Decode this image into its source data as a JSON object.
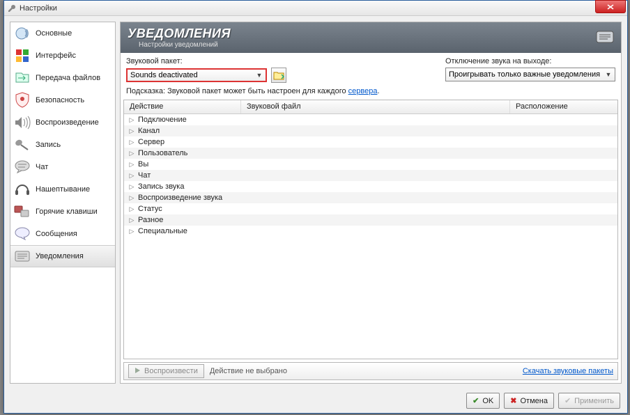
{
  "window": {
    "title": "Настройки"
  },
  "sidebar": {
    "items": [
      {
        "label": "Основные"
      },
      {
        "label": "Интерфейс"
      },
      {
        "label": "Передача файлов"
      },
      {
        "label": "Безопасность"
      },
      {
        "label": "Воспроизведение"
      },
      {
        "label": "Запись"
      },
      {
        "label": "Чат"
      },
      {
        "label": "Нашептывание"
      },
      {
        "label": "Горячие клавиши"
      },
      {
        "label": "Сообщения"
      },
      {
        "label": "Уведомления"
      }
    ]
  },
  "header": {
    "title": "УВЕДОМЛЕНИЯ",
    "subtitle": "Настройки уведомлений"
  },
  "controls": {
    "sound_pack_label": "Звуковой пакет:",
    "sound_pack_value": "Sounds deactivated",
    "mute_label": "Отключение звука на выходе:",
    "mute_value": "Проигрывать только важные уведомления"
  },
  "hint": {
    "prefix": "Подсказка: Звуковой пакет может быть настроен для каждого ",
    "link": "сервера",
    "suffix": "."
  },
  "table": {
    "col_action": "Действие",
    "col_file": "Звуковой файл",
    "col_location": "Расположение",
    "rows": [
      {
        "label": "Подключение"
      },
      {
        "label": "Канал"
      },
      {
        "label": "Сервер"
      },
      {
        "label": "Пользователь"
      },
      {
        "label": "Вы"
      },
      {
        "label": "Чат"
      },
      {
        "label": "Запись звука"
      },
      {
        "label": "Воспроизведение звука"
      },
      {
        "label": "Статус"
      },
      {
        "label": "Разное"
      },
      {
        "label": "Специальные"
      }
    ]
  },
  "bottom": {
    "play": "Воспроизвести",
    "none": "Действие не выбрано",
    "download": "Скачать звуковые пакеты"
  },
  "buttons": {
    "ok": "OK",
    "cancel": "Отмена",
    "apply": "Применить"
  }
}
